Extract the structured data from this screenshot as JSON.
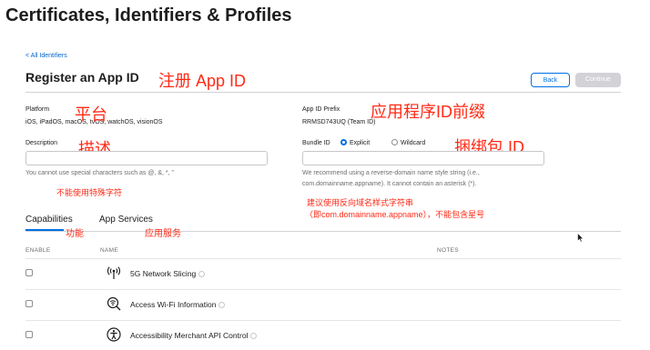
{
  "header": {
    "title": "Certificates, Identifiers & Profiles"
  },
  "nav": {
    "back_link": "< All Identifiers"
  },
  "page": {
    "heading": "Register an App ID"
  },
  "actions": {
    "back_label": "Back",
    "continue_label": "Continue"
  },
  "platform": {
    "label": "Platform",
    "value": "iOS, iPadOS, macOS, tvOS, watchOS, visionOS"
  },
  "prefix": {
    "label": "App ID Prefix",
    "value": "RRMSD743UQ (Team ID)"
  },
  "description": {
    "label": "Description",
    "value": "",
    "hint": "You cannot use special characters such as @, &, *, \""
  },
  "bundle": {
    "label": "Bundle ID",
    "option_explicit": "Explicit",
    "option_wildcard": "Wildcard",
    "selected": "Explicit",
    "value": "",
    "hint_line1": "We recommend using a reverse-domain name style string (i.e.,",
    "hint_line2": "com.domainname.appname). It cannot contain an asterisk (*)."
  },
  "annotations": {
    "register": "注册 App ID",
    "platform": "平台",
    "prefix": "应用程序ID前缀",
    "description": "描述",
    "bundle": "捆绑包 ID",
    "no_special": "不能使用特殊字符",
    "reverse_line1": "建议使用反向域名样式字符串",
    "reverse_line2": "（即com.domainname.appname），不能包含星号",
    "capabilities": "功能",
    "app_services": "应用服务"
  },
  "tabs": [
    {
      "label": "Capabilities",
      "active": true
    },
    {
      "label": "App Services",
      "active": false
    }
  ],
  "table": {
    "headers": {
      "enable": "ENABLE",
      "name": "NAME",
      "notes": "NOTES"
    },
    "rows": [
      {
        "name": "5G Network Slicing",
        "icon": "antenna-signal-icon",
        "enabled": false
      },
      {
        "name": "Access Wi-Fi Information",
        "icon": "wifi-search-icon",
        "enabled": false
      },
      {
        "name": "Accessibility Merchant API Control",
        "icon": "accessibility-icon",
        "enabled": false
      }
    ]
  },
  "colors": {
    "accent": "#0071e3",
    "annotation": "#ff2a16",
    "link": "#0066cc"
  }
}
